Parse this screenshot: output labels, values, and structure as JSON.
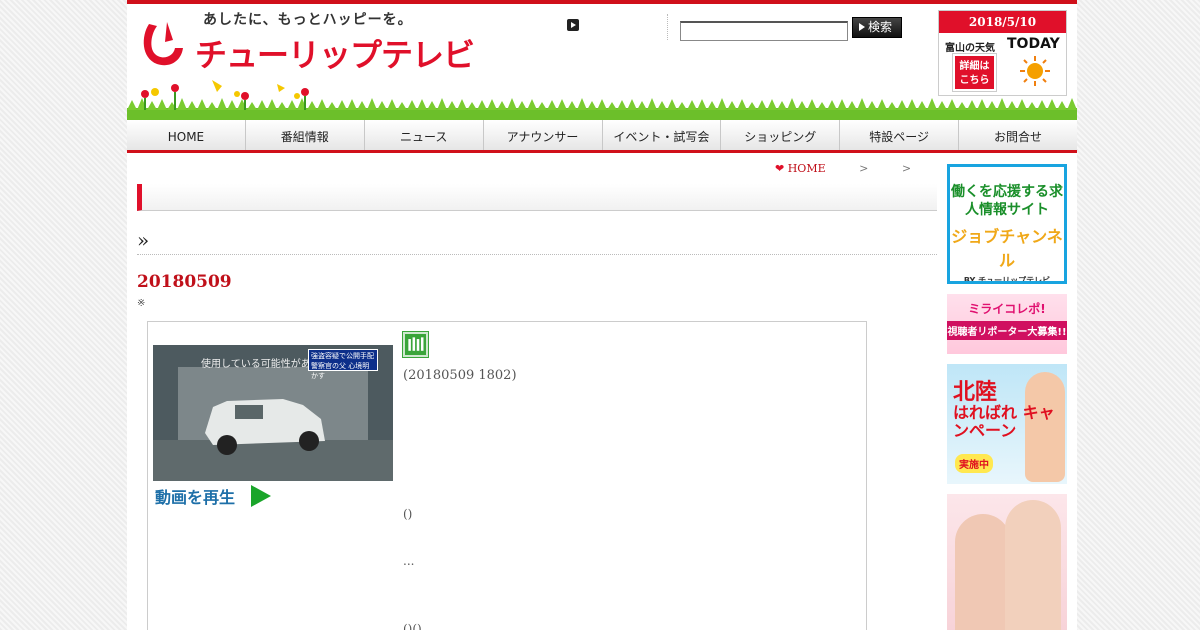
{
  "header": {
    "tagline": "あしたに、もっとハッピーを。",
    "logo_text": "チューリップテレビ",
    "search_button": "検索",
    "search_value": ""
  },
  "weather": {
    "date": "2018/5/10",
    "pref": "富山の天気",
    "today": "TODAY",
    "detail": "詳細は こちら",
    "icon": "sun-icon"
  },
  "nav": [
    "HOME",
    "番組情報",
    "ニュース",
    "アナウンサー",
    "イベント・試写会",
    "ショッピング",
    "特設ページ",
    "お問合せ"
  ],
  "breadcrumb": {
    "home": "HOME",
    "sep1": ">",
    "sep2": ">"
  },
  "content": {
    "raquo": "»",
    "date_title": "20180509",
    "note": "※",
    "thumb_caption": "使用している可能性がある",
    "thumb_label": "強盗容疑で公開手配 警察官の父 心境明かす",
    "play_label": "動画を再生",
    "timestamp": "(20180509 1802)",
    "line1": "()",
    "line2": "...",
    "line3": "()()"
  },
  "banners": {
    "job_l1": "働くを応援する求人情報サイト",
    "job_l2": "ジョブチャンネル",
    "job_l3": "BY チューリップテレビ",
    "reporter_l1": "ミライコレポ!",
    "reporter_l2": "視聴者リポーター大募集!!",
    "hokuriku_l1": "北陸",
    "hokuriku_l2": "はればれ キャンペーン",
    "hokuriku_l3": "実施中"
  },
  "colors": {
    "brand_red": "#e0102a",
    "link_blue": "#1d6fa8",
    "play_green": "#1aa52a"
  }
}
